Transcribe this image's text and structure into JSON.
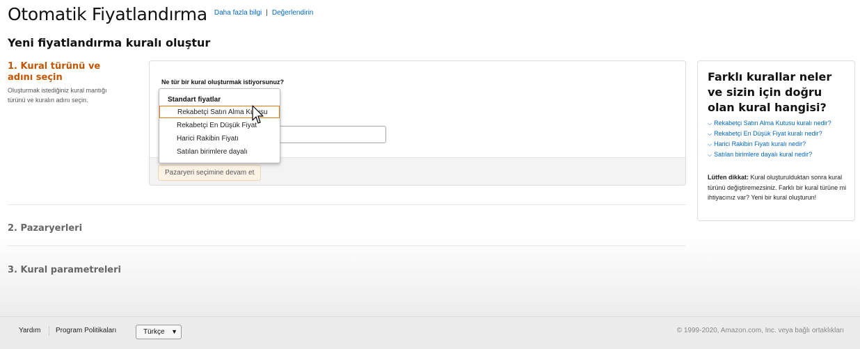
{
  "header": {
    "title": "Otomatik Fiyatlandırma",
    "link_more": "Daha fazla bilgi",
    "separator": "|",
    "link_rate": "Değerlendirin"
  },
  "subtitle": "Yeni fiyatlandırma kuralı oluştur",
  "step1": {
    "title": "1. Kural türünü ve adını seçin",
    "desc": "Oluşturmak istediğiniz kural mantığı türünü ve kuralın adını seçin."
  },
  "form": {
    "question": "Ne tür bir kural oluşturmak istiyorsunuz?",
    "continue_label": "Pazaryeri seçimine devam et"
  },
  "dropdown": {
    "group_label": "Standart fiyatlar",
    "options": [
      "Rekabetçi Satın Alma Kutusu",
      "Rekabetçi En Düşük Fiyat",
      "Harici Rakibin Fiyatı",
      "Satılan birimlere dayalı"
    ],
    "selected_index": 0
  },
  "steps": {
    "step2": "2. Pazaryerleri",
    "step3": "3. Kural parametreleri"
  },
  "help": {
    "title": "Farklı kurallar neler ve sizin için doğru olan kural hangisi?",
    "links": [
      "Rekabetçi Satın Alma Kutusu kuralı nedir?",
      "Rekabetçi En Düşük Fiyat kuralı nedir?",
      "Harici Rakibin Fiyatı kuralı nedir?",
      "Satılan birimlere dayalı kural nedir?"
    ],
    "note_bold": "Lütfen dikkat:",
    "note_text": " Kural oluşturulduktan sonra kural türünü değiştiremezsiniz. Farklı bir kural türüne mi ihtiyacınız var? Yeni bir kural oluşturun!"
  },
  "footer": {
    "help": "Yardım",
    "policies": "Program Politikaları",
    "language": "Türkçe",
    "copyright": "© 1999-2020, Amazon.com, Inc. veya bağlı ortaklıkları"
  },
  "colors": {
    "link": "#0066c0",
    "step_active": "#c45500",
    "selection_border": "#e47911"
  },
  "icons": {
    "link_chevron": "chevron-down-icon",
    "language_arrow": "chevron-down-icon",
    "pointer": "hand-cursor-icon"
  }
}
